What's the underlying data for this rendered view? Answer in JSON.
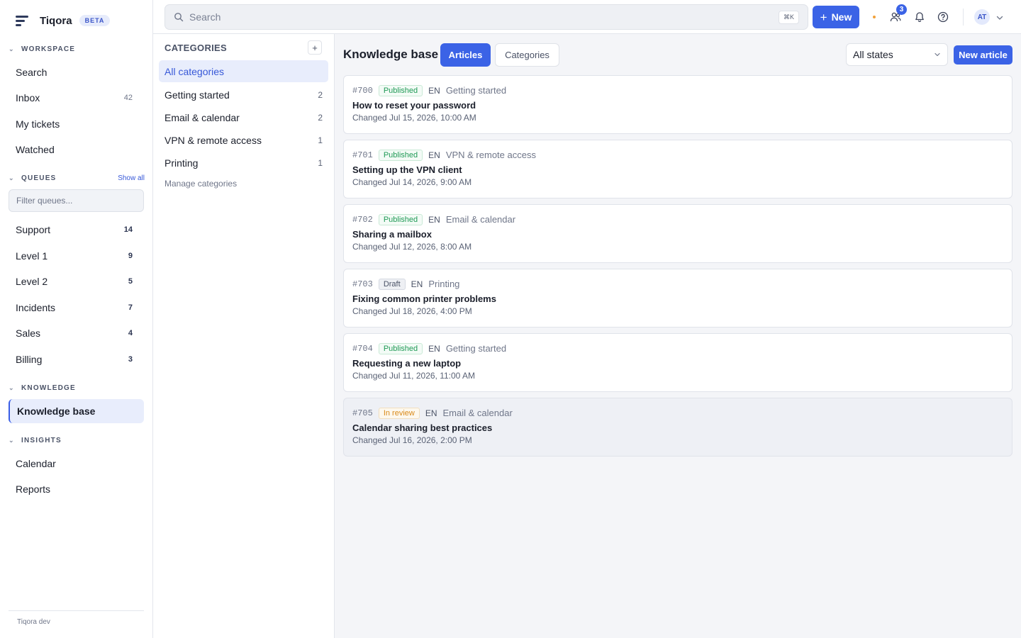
{
  "brand": {
    "name": "Tiqora",
    "badge": "BETA"
  },
  "sidebar": {
    "workspace_header": "WORKSPACE",
    "workspace_items": [
      {
        "label": "Search",
        "count": ""
      },
      {
        "label": "Inbox",
        "count": "42"
      },
      {
        "label": "My tickets",
        "count": ""
      },
      {
        "label": "Watched",
        "count": ""
      }
    ],
    "queues_header": "QUEUES",
    "show_all": "Show all",
    "filter_placeholder": "Filter queues...",
    "queues": [
      {
        "label": "Support",
        "count": "14"
      },
      {
        "label": "Level 1",
        "count": "9"
      },
      {
        "label": "Level 2",
        "count": "5"
      },
      {
        "label": "Incidents",
        "count": "7"
      },
      {
        "label": "Sales",
        "count": "4"
      },
      {
        "label": "Billing",
        "count": "3"
      }
    ],
    "knowledge_header": "KNOWLEDGE",
    "knowledge_items": [
      {
        "label": "Knowledge base",
        "active": true
      }
    ],
    "insights_header": "INSIGHTS",
    "insights_items": [
      {
        "label": "Calendar"
      },
      {
        "label": "Reports"
      }
    ],
    "footer": "Tiqora dev"
  },
  "topbar": {
    "search_placeholder": "Search",
    "shortcut": "⌘K",
    "new_label": "New",
    "team_badge": "3",
    "avatar_initials": "AT",
    "icons": [
      "search-icon",
      "plus-icon",
      "team-icon",
      "bell-icon",
      "help-icon",
      "chevron-down-icon"
    ]
  },
  "categories": {
    "title": "CATEGORIES",
    "add_label": "+",
    "items": [
      {
        "label": "All categories",
        "count": "",
        "active": true
      },
      {
        "label": "Getting started",
        "count": "2"
      },
      {
        "label": "Email & calendar",
        "count": "2"
      },
      {
        "label": "VPN & remote access",
        "count": "1"
      },
      {
        "label": "Printing",
        "count": "1"
      }
    ],
    "manage_label": "Manage categories"
  },
  "main": {
    "title": "Knowledge base",
    "tabs": [
      {
        "label": "Articles",
        "active": true
      },
      {
        "label": "Categories",
        "active": false
      }
    ],
    "state_filter": "All states",
    "new_article_label": "New article",
    "articles": [
      {
        "id": "#700",
        "status": "Published",
        "status_kind": "published",
        "lang": "EN",
        "category": "Getting started",
        "title": "How to reset your password",
        "changed": "Changed Jul 15, 2026, 10:00 AM"
      },
      {
        "id": "#701",
        "status": "Published",
        "status_kind": "published",
        "lang": "EN",
        "category": "VPN & remote access",
        "title": "Setting up the VPN client",
        "changed": "Changed Jul 14, 2026, 9:00 AM"
      },
      {
        "id": "#702",
        "status": "Published",
        "status_kind": "published",
        "lang": "EN",
        "category": "Email & calendar",
        "title": "Sharing a mailbox",
        "changed": "Changed Jul 12, 2026, 8:00 AM"
      },
      {
        "id": "#703",
        "status": "Draft",
        "status_kind": "draft",
        "lang": "EN",
        "category": "Printing",
        "title": "Fixing common printer problems",
        "changed": "Changed Jul 18, 2026, 4:00 PM"
      },
      {
        "id": "#704",
        "status": "Published",
        "status_kind": "published",
        "lang": "EN",
        "category": "Getting started",
        "title": "Requesting a new laptop",
        "changed": "Changed Jul 11, 2026, 11:00 AM"
      },
      {
        "id": "#705",
        "status": "In review",
        "status_kind": "review",
        "lang": "EN",
        "category": "Email & calendar",
        "title": "Calendar sharing best practices",
        "changed": "Changed Jul 16, 2026, 2:00 PM"
      }
    ]
  },
  "colors": {
    "accent": "#3b63e6",
    "published": "#1f9a55",
    "review": "#d98a1a",
    "draft": "#4a5266"
  }
}
